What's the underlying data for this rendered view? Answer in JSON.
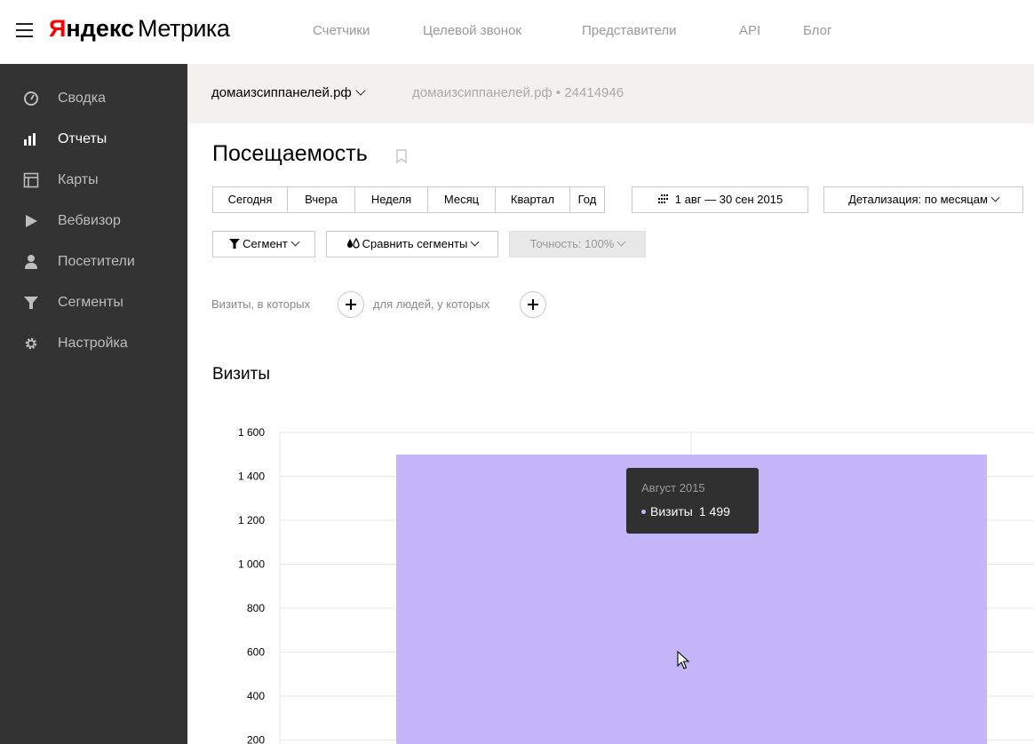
{
  "header": {
    "logo_ya": "Я",
    "logo_ndex": "ндекс",
    "logo_metrika": "Метрика",
    "nav": [
      "Счетчики",
      "Целевой звонок",
      "Представители",
      "API",
      "Блог"
    ]
  },
  "sidebar": {
    "items": [
      {
        "label": "Сводка",
        "icon": "dashboard-icon",
        "active": false
      },
      {
        "label": "Отчеты",
        "icon": "reports-icon",
        "active": true
      },
      {
        "label": "Карты",
        "icon": "maps-icon",
        "active": false
      },
      {
        "label": "Вебвизор",
        "icon": "play-icon",
        "active": false
      },
      {
        "label": "Посетители",
        "icon": "user-icon",
        "active": false
      },
      {
        "label": "Сегменты",
        "icon": "funnel-icon",
        "active": false
      },
      {
        "label": "Настройка",
        "icon": "gear-icon",
        "active": false
      }
    ]
  },
  "counter": {
    "name": "домаизсиппанелей.рф",
    "info": "домаизсиппанелей.рф • 24414946"
  },
  "page": {
    "title": "Посещаемость"
  },
  "periods": [
    "Сегодня",
    "Вчера",
    "Неделя",
    "Месяц",
    "Квартал",
    "Год"
  ],
  "date_range": "1 авг — 30 сен 2015",
  "detail": "Детализация: по месяцам",
  "segment_button": "Сегмент",
  "compare_button": "Сравнить сегменты",
  "accuracy": "Точность: 100%",
  "filters": {
    "visits_label": "Визиты, в которых",
    "people_label": "для людей, у которых"
  },
  "chart_data": {
    "type": "bar",
    "title": "Визиты",
    "categories": [
      "Август 2015"
    ],
    "series": [
      {
        "name": "Визиты",
        "values": [
          1499
        ]
      }
    ],
    "y_ticks": [
      200,
      400,
      600,
      800,
      1000,
      1200,
      1400,
      1600
    ],
    "y_tick_labels": [
      "200",
      "400",
      "600",
      "800",
      "1 000",
      "1 200",
      "1 400",
      "1 600"
    ],
    "ylim": [
      0,
      1600
    ],
    "bar_color": "#c3b5f7",
    "grid": true
  },
  "tooltip": {
    "title": "Август 2015",
    "series_name": "Визиты",
    "value": "1 499"
  },
  "colors": {
    "sidebar_bg": "#333333",
    "counterbar_bg": "#f2f1ee",
    "logo_red": "#ff0000"
  }
}
